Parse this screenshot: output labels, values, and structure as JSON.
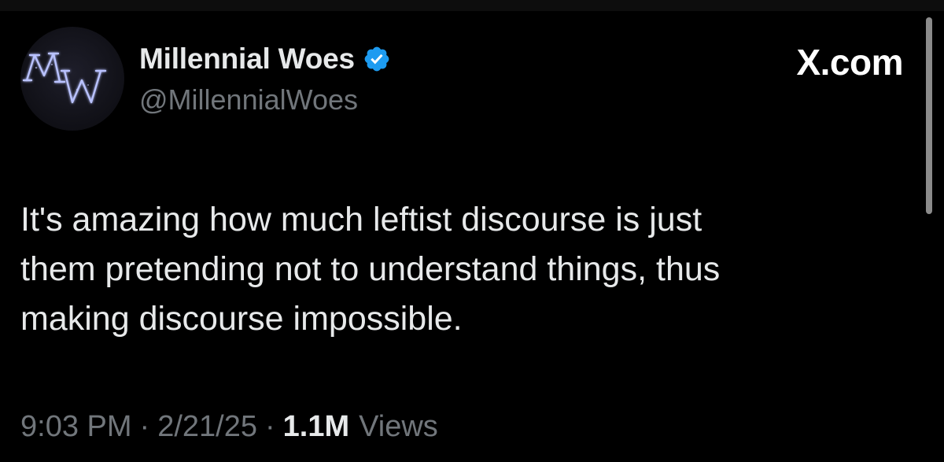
{
  "author": {
    "avatar_text": "MW",
    "display_name": "Millennial Woes",
    "handle": "@MillennialWoes",
    "verified_icon": "verified-badge-icon"
  },
  "brand": {
    "label": "X.com"
  },
  "tweet": {
    "text": "It's amazing how much leftist discourse is just\nthem pretending not to understand things, thus\nmaking discourse impossible."
  },
  "meta": {
    "time": "9:03 PM",
    "separator": "·",
    "date": "2/21/25",
    "views_count": "1.1M",
    "views_label": "Views"
  },
  "colors": {
    "background": "#000000",
    "text_primary": "#e7e9ea",
    "text_secondary": "#71767b",
    "verified_blue": "#1d9bf0"
  }
}
